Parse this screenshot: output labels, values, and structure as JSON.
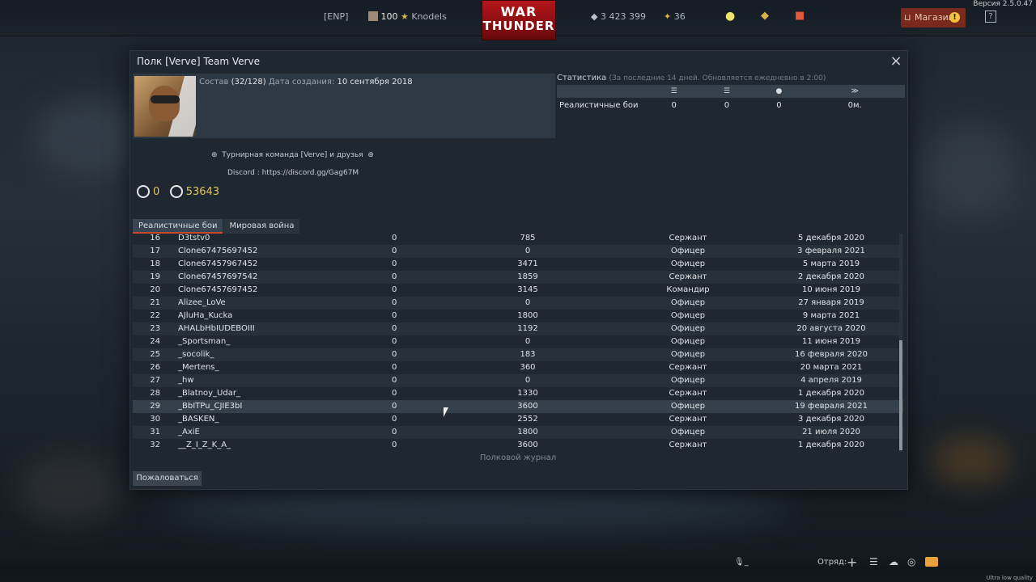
{
  "topbar": {
    "region": "[ENP]",
    "player_level": "100",
    "player_name": "Knodels",
    "silver": "3 423 399",
    "gold": "36",
    "logo_line1": "WAR",
    "logo_line2": "THUNDER",
    "shop_label": "Магазин",
    "help_label": "?",
    "version": "Версия 2.5.0.47"
  },
  "modal": {
    "title": "Полк [Verve] Team Verve",
    "members_label": "Состав",
    "members_value": "(32/128)",
    "created_label": "Дата создания:",
    "created_value": "10 сентября 2018",
    "description_line1": "Турнирная команда [Verve] и друзья",
    "description_line2": "Discord : https://discord.gg/Gag67M",
    "score_left": "0",
    "score_right": "53643",
    "tabs": [
      "Реалистичные бои",
      "Мировая война"
    ],
    "journal_label": "Полковой журнал",
    "report_label": "Пожаловаться"
  },
  "stats": {
    "title": "Статистика",
    "note": "(За последние 14 дней. Обновляется ежедневно в 2:00)",
    "row_label": "Реалистичные бои",
    "values": [
      "0",
      "0",
      "0",
      "0м."
    ]
  },
  "members": [
    {
      "num": "16",
      "name": "D3tstv0",
      "a": "0",
      "b": "785",
      "rank": "Сержант",
      "date": "5 декабря 2020"
    },
    {
      "num": "17",
      "name": "Clone67475697452",
      "a": "0",
      "b": "0",
      "rank": "Офицер",
      "date": "3 февраля 2021"
    },
    {
      "num": "18",
      "name": "Clone67457967452",
      "a": "0",
      "b": "3471",
      "rank": "Офицер",
      "date": "5 марта 2019"
    },
    {
      "num": "19",
      "name": "Clone67457697542",
      "a": "0",
      "b": "1859",
      "rank": "Сержант",
      "date": "2 декабря 2020"
    },
    {
      "num": "20",
      "name": "Clone67457697452",
      "a": "0",
      "b": "3145",
      "rank": "Командир",
      "date": "10 июня 2019"
    },
    {
      "num": "21",
      "name": "Alizee_LoVe",
      "a": "0",
      "b": "0",
      "rank": "Офицер",
      "date": "27 января 2019"
    },
    {
      "num": "22",
      "name": "AJluHa_Kucka",
      "a": "0",
      "b": "1800",
      "rank": "Офицер",
      "date": "9 марта 2021"
    },
    {
      "num": "23",
      "name": "AHALbHbIUDEBOIII",
      "a": "0",
      "b": "1192",
      "rank": "Офицер",
      "date": "20 августа 2020"
    },
    {
      "num": "24",
      "name": "_Sportsman_",
      "a": "0",
      "b": "0",
      "rank": "Офицер",
      "date": "11 июня 2019"
    },
    {
      "num": "25",
      "name": "_socolik_",
      "a": "0",
      "b": "183",
      "rank": "Офицер",
      "date": "16 февраля 2020"
    },
    {
      "num": "26",
      "name": "_Mertens_",
      "a": "0",
      "b": "360",
      "rank": "Сержант",
      "date": "20 марта 2021"
    },
    {
      "num": "27",
      "name": "_hw",
      "a": "0",
      "b": "0",
      "rank": "Офицер",
      "date": "4 апреля 2019"
    },
    {
      "num": "28",
      "name": "_Blatnoy_Udar_",
      "a": "0",
      "b": "1330",
      "rank": "Сержант",
      "date": "1 декабря 2020"
    },
    {
      "num": "29",
      "name": "_BbITPu_CJIE3bI",
      "a": "0",
      "b": "3600",
      "rank": "Офицер",
      "date": "19 февраля 2021"
    },
    {
      "num": "30",
      "name": "_BASKEN_",
      "a": "0",
      "b": "2552",
      "rank": "Сержант",
      "date": "3 декабря 2020"
    },
    {
      "num": "31",
      "name": "_AxiE",
      "a": "0",
      "b": "1800",
      "rank": "Офицер",
      "date": "21 июля 2020"
    },
    {
      "num": "32",
      "name": "__Z_I_Z_K_A_",
      "a": "0",
      "b": "3600",
      "rank": "Сержант",
      "date": "1 декабря 2020"
    }
  ],
  "bottombar": {
    "mic_label": "_",
    "squad_label": "Отряд:",
    "add_label": "+",
    "quality": "Ultra low quality"
  },
  "colors": {
    "accent": "#c44a2e",
    "gold": "#e0c55a",
    "logo_red": "#b3151a"
  }
}
